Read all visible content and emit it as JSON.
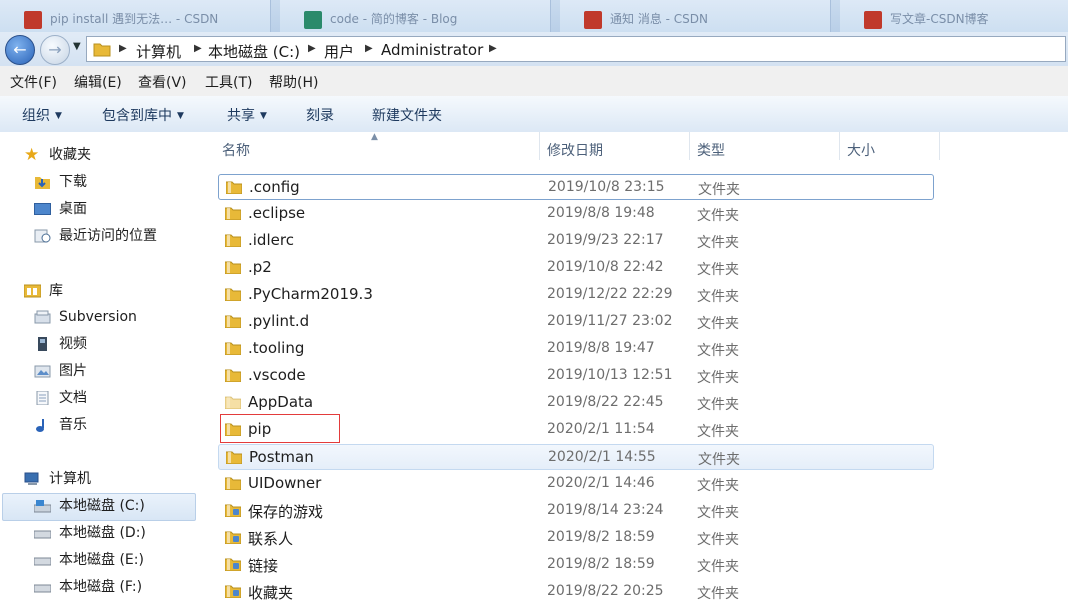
{
  "browser_tabs": [
    {
      "title": "pip install 遇到无法… - CSDN",
      "color": "#c0392b"
    },
    {
      "title": "code - 简的博客 - Blog",
      "color": "#2b8a6b"
    },
    {
      "title": "通知 消息 - CSDN",
      "color": "#c0392b"
    },
    {
      "title": "写文章-CSDN博客",
      "color": "#c0392b"
    }
  ],
  "nav": {
    "back_icon": "back-arrow-icon",
    "forward_icon": "forward-arrow-icon",
    "breadcrumb": [
      "计算机",
      "本地磁盘 (C:)",
      "用户",
      "Administrator"
    ]
  },
  "menu": [
    "文件(F)",
    "编辑(E)",
    "查看(V)",
    "工具(T)",
    "帮助(H)"
  ],
  "commands": [
    {
      "label": "组织",
      "dropdown": true
    },
    {
      "label": "包含到库中",
      "dropdown": true
    },
    {
      "label": "共享",
      "dropdown": true
    },
    {
      "label": "刻录",
      "dropdown": false
    },
    {
      "label": "新建文件夹",
      "dropdown": false
    }
  ],
  "sidebar": {
    "favorites": {
      "label": "收藏夹",
      "items": [
        "下载",
        "桌面",
        "最近访问的位置"
      ]
    },
    "libraries": {
      "label": "库",
      "items": [
        "Subversion",
        "视频",
        "图片",
        "文档",
        "音乐"
      ]
    },
    "computer": {
      "label": "计算机",
      "items": [
        "本地磁盘 (C:)",
        "本地磁盘 (D:)",
        "本地磁盘 (E:)",
        "本地磁盘 (F:)"
      ],
      "selected": "本地磁盘 (C:)"
    }
  },
  "columns": [
    "名称",
    "修改日期",
    "类型",
    "大小"
  ],
  "files": [
    {
      "name": ".config",
      "date": "2019/10/8 23:15",
      "type": "文件夹",
      "state": "selected"
    },
    {
      "name": ".eclipse",
      "date": "2019/8/8 19:48",
      "type": "文件夹"
    },
    {
      "name": ".idlerc",
      "date": "2019/9/23 22:17",
      "type": "文件夹"
    },
    {
      "name": ".p2",
      "date": "2019/10/8 22:42",
      "type": "文件夹"
    },
    {
      "name": ".PyCharm2019.3",
      "date": "2019/12/22 22:29",
      "type": "文件夹"
    },
    {
      "name": ".pylint.d",
      "date": "2019/11/27 23:02",
      "type": "文件夹"
    },
    {
      "name": ".tooling",
      "date": "2019/8/8 19:47",
      "type": "文件夹"
    },
    {
      "name": ".vscode",
      "date": "2019/10/13 12:51",
      "type": "文件夹"
    },
    {
      "name": "AppData",
      "date": "2019/8/22 22:45",
      "type": "文件夹",
      "hidden": true
    },
    {
      "name": "pip",
      "date": "2020/2/1 11:54",
      "type": "文件夹",
      "annotated": true
    },
    {
      "name": "Postman",
      "date": "2020/2/1 14:55",
      "type": "文件夹",
      "state": "hover"
    },
    {
      "name": "UIDowner",
      "date": "2020/2/1 14:46",
      "type": "文件夹"
    },
    {
      "name": "保存的游戏",
      "date": "2019/8/14 23:24",
      "type": "文件夹",
      "icon": "saved-games-folder-icon"
    },
    {
      "name": "联系人",
      "date": "2019/8/2 18:59",
      "type": "文件夹",
      "icon": "contacts-folder-icon"
    },
    {
      "name": "链接",
      "date": "2019/8/2 18:59",
      "type": "文件夹",
      "icon": "links-folder-icon"
    },
    {
      "name": "收藏夹",
      "date": "2019/8/22 20:25",
      "type": "文件夹",
      "icon": "favorites-folder-icon"
    }
  ],
  "colors": {
    "folder": "#e8b938",
    "selection_border": "#7da2ce",
    "annotation": "#e33b3b",
    "title_blue": "#1e3a5f"
  }
}
